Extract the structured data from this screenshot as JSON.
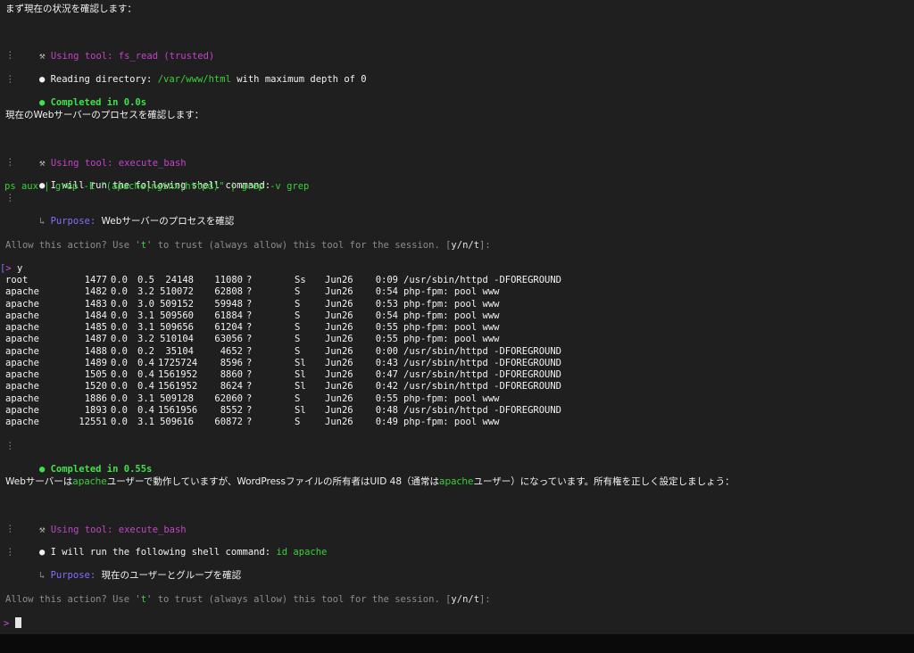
{
  "intro": "まず現在の状況を確認します：",
  "tool_prefix": "Using tool:",
  "bullet_glyph": "●",
  "gutter_glyph": "⋮",
  "arrow_glyph": "↳",
  "block1": {
    "tool_name": "fs_read (trusted)",
    "reading_prefix": "Reading directory: ",
    "reading_path": "/var/www/html",
    "reading_suffix": " with maximum depth of 0",
    "completed": "Completed in 0.0s"
  },
  "section2_heading": "現在のWebサーバーのプロセスを確認します：",
  "block2": {
    "tool_name": "execute_bash",
    "run_text": "I will run the following shell command:",
    "command": "ps aux | grep -E \"(apache|nginx|httpd)\" | grep -v grep",
    "purpose_label": "Purpose:",
    "purpose_text": "Webサーバーのプロセスを確認",
    "allow_prefix": "Allow this action? Use '",
    "allow_t": "t",
    "allow_middle": "' to trust (always allow) this tool for the session. [",
    "allow_options": "y/n/t",
    "allow_suffix": "]:",
    "prompt_glyph": ">",
    "prompt_answer": "y",
    "completed": "Completed in 0.55s"
  },
  "processes": [
    {
      "user": "root",
      "pid": "1477",
      "cpu": "0.0",
      "mem": "0.5",
      "vsz": "24148",
      "rss": "11080",
      "tty": "?",
      "stat": "Ss",
      "start": "Jun26",
      "time": "0:09",
      "cmd": "/usr/sbin/httpd -DFOREGROUND"
    },
    {
      "user": "apache",
      "pid": "1482",
      "cpu": "0.0",
      "mem": "3.2",
      "vsz": "510072",
      "rss": "62808",
      "tty": "?",
      "stat": "S",
      "start": "Jun26",
      "time": "0:54",
      "cmd": "php-fpm: pool www"
    },
    {
      "user": "apache",
      "pid": "1483",
      "cpu": "0.0",
      "mem": "3.0",
      "vsz": "509152",
      "rss": "59948",
      "tty": "?",
      "stat": "S",
      "start": "Jun26",
      "time": "0:53",
      "cmd": "php-fpm: pool www"
    },
    {
      "user": "apache",
      "pid": "1484",
      "cpu": "0.0",
      "mem": "3.1",
      "vsz": "509560",
      "rss": "61884",
      "tty": "?",
      "stat": "S",
      "start": "Jun26",
      "time": "0:54",
      "cmd": "php-fpm: pool www"
    },
    {
      "user": "apache",
      "pid": "1485",
      "cpu": "0.0",
      "mem": "3.1",
      "vsz": "509656",
      "rss": "61204",
      "tty": "?",
      "stat": "S",
      "start": "Jun26",
      "time": "0:55",
      "cmd": "php-fpm: pool www"
    },
    {
      "user": "apache",
      "pid": "1487",
      "cpu": "0.0",
      "mem": "3.2",
      "vsz": "510104",
      "rss": "63056",
      "tty": "?",
      "stat": "S",
      "start": "Jun26",
      "time": "0:55",
      "cmd": "php-fpm: pool www"
    },
    {
      "user": "apache",
      "pid": "1488",
      "cpu": "0.0",
      "mem": "0.2",
      "vsz": "35104",
      "rss": "4652",
      "tty": "?",
      "stat": "S",
      "start": "Jun26",
      "time": "0:00",
      "cmd": "/usr/sbin/httpd -DFOREGROUND"
    },
    {
      "user": "apache",
      "pid": "1489",
      "cpu": "0.0",
      "mem": "0.4",
      "vsz": "1725724",
      "rss": "8596",
      "tty": "?",
      "stat": "Sl",
      "start": "Jun26",
      "time": "0:43",
      "cmd": "/usr/sbin/httpd -DFOREGROUND"
    },
    {
      "user": "apache",
      "pid": "1505",
      "cpu": "0.0",
      "mem": "0.4",
      "vsz": "1561952",
      "rss": "8860",
      "tty": "?",
      "stat": "Sl",
      "start": "Jun26",
      "time": "0:47",
      "cmd": "/usr/sbin/httpd -DFOREGROUND"
    },
    {
      "user": "apache",
      "pid": "1520",
      "cpu": "0.0",
      "mem": "0.4",
      "vsz": "1561952",
      "rss": "8624",
      "tty": "?",
      "stat": "Sl",
      "start": "Jun26",
      "time": "0:42",
      "cmd": "/usr/sbin/httpd -DFOREGROUND"
    },
    {
      "user": "apache",
      "pid": "1886",
      "cpu": "0.0",
      "mem": "3.1",
      "vsz": "509128",
      "rss": "62060",
      "tty": "?",
      "stat": "S",
      "start": "Jun26",
      "time": "0:55",
      "cmd": "php-fpm: pool www"
    },
    {
      "user": "apache",
      "pid": "1893",
      "cpu": "0.0",
      "mem": "0.4",
      "vsz": "1561956",
      "rss": "8552",
      "tty": "?",
      "stat": "Sl",
      "start": "Jun26",
      "time": "0:48",
      "cmd": "/usr/sbin/httpd -DFOREGROUND"
    },
    {
      "user": "apache",
      "pid": "12551",
      "cpu": "0.0",
      "mem": "3.1",
      "vsz": "509616",
      "rss": "60872",
      "tty": "?",
      "stat": "S",
      "start": "Jun26",
      "time": "0:49",
      "cmd": "php-fpm: pool www"
    }
  ],
  "analysis": {
    "p1": "Webサーバーは",
    "apache1": "apache",
    "p2": "ユーザーで動作していますが、WordPressファイルの所有者はUID 48（通常は",
    "apache2": "apache",
    "p3": "ユーザー）になっています。所有権を正しく設定しましょう："
  },
  "block3": {
    "tool_name": "execute_bash",
    "run_text": "I will run the following shell command: ",
    "command": "id apache",
    "purpose_label": "Purpose:",
    "purpose_text": "現在のユーザーとグループを確認",
    "prompt_glyph": ">"
  },
  "colors": {
    "background": "#1f1f1f",
    "tool_purple": "#c343c9",
    "path_green": "#3ad13a",
    "completed_green": "#3fe14a",
    "purpose_violet": "#8a6cff",
    "dim_grey": "#8c8c8c"
  }
}
